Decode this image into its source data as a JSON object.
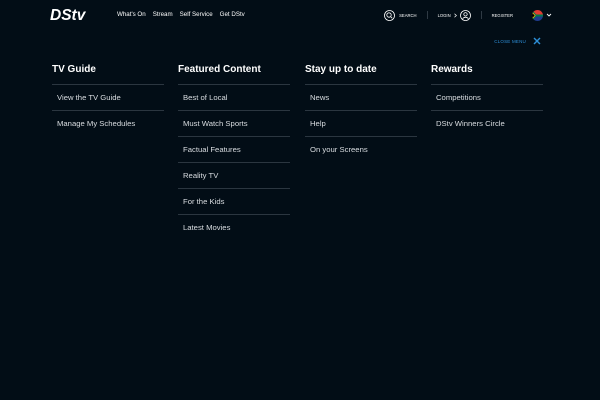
{
  "header": {
    "logo_text": "DStv",
    "nav": [
      "What's On",
      "Stream",
      "Self Service",
      "Get DStv"
    ],
    "search_label": "SEARCH",
    "login_label": "LOGIN",
    "register_label": "REGISTER",
    "icons": [
      "dstv-logo",
      "search-icon",
      "user-icon",
      "south-africa-flag-icon",
      "chevron-down-icon"
    ]
  },
  "close_menu": {
    "label": "CLOSE MENU",
    "icon": "close-icon"
  },
  "colors": {
    "background": "#020d16",
    "accent": "#2d8fd8",
    "divider": "#2b3640",
    "text": "#ffffff"
  },
  "columns": [
    {
      "title": "TV Guide",
      "items": [
        "View the TV Guide",
        "Manage My Schedules"
      ]
    },
    {
      "title": "Featured Content",
      "items": [
        "Best of Local",
        "Must Watch Sports",
        "Factual Features",
        "Reality TV",
        "For the Kids",
        "Latest Movies"
      ]
    },
    {
      "title": "Stay up to date",
      "items": [
        "News",
        "Help",
        "On your Screens"
      ]
    },
    {
      "title": "Rewards",
      "items": [
        "Competitions",
        "DStv Winners Circle"
      ]
    }
  ]
}
